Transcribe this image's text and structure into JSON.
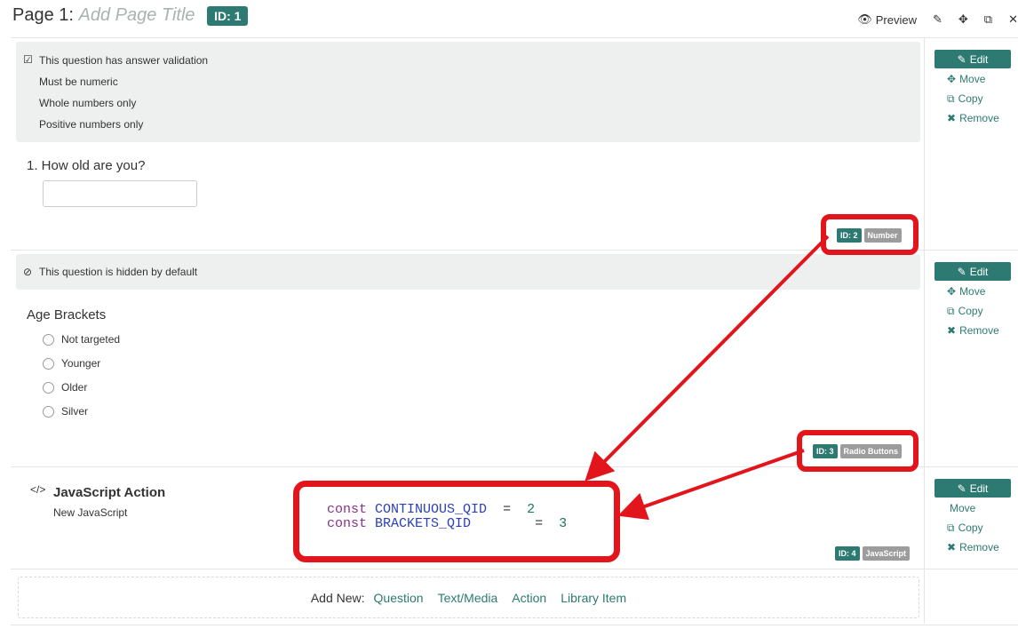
{
  "header": {
    "page_label": "Page 1:",
    "page_title_placeholder": "Add Page Title",
    "page_id": "ID: 1",
    "toolbar": {
      "preview": "Preview"
    }
  },
  "q1": {
    "validation_header": "This question has answer validation",
    "validations": [
      "Must be numeric",
      "Whole numbers only",
      "Positive numbers only"
    ],
    "title": "1. How old are you?",
    "id_tag": "ID: 2",
    "type_tag": "Number"
  },
  "q2": {
    "hidden_note": "This question is hidden by default",
    "title": "Age Brackets",
    "options": [
      "Not targeted",
      "Younger",
      "Older",
      "Silver"
    ],
    "id_tag": "ID: 3",
    "type_tag": "Radio Buttons"
  },
  "q3": {
    "icon": "</>",
    "title": "JavaScript Action",
    "subtitle": "New JavaScript",
    "id_tag": "ID: 4",
    "type_tag": "JavaScript",
    "code": {
      "line1": {
        "kw": "const",
        "var": "CONTINUOUS_QID",
        "eq": "=",
        "val": "2"
      },
      "line2": {
        "kw": "const",
        "var": "BRACKETS_QID",
        "eq": "=",
        "val": "3"
      }
    }
  },
  "side_actions": {
    "edit": "Edit",
    "move": "Move",
    "copy": "Copy",
    "remove": "Remove"
  },
  "add_new": {
    "label": "Add New:",
    "links": [
      "Question",
      "Text/Media",
      "Action",
      "Library Item"
    ]
  },
  "colors": {
    "accent": "#2d7a72",
    "annotation": "#e3151c",
    "panel": "#eef0f0"
  }
}
